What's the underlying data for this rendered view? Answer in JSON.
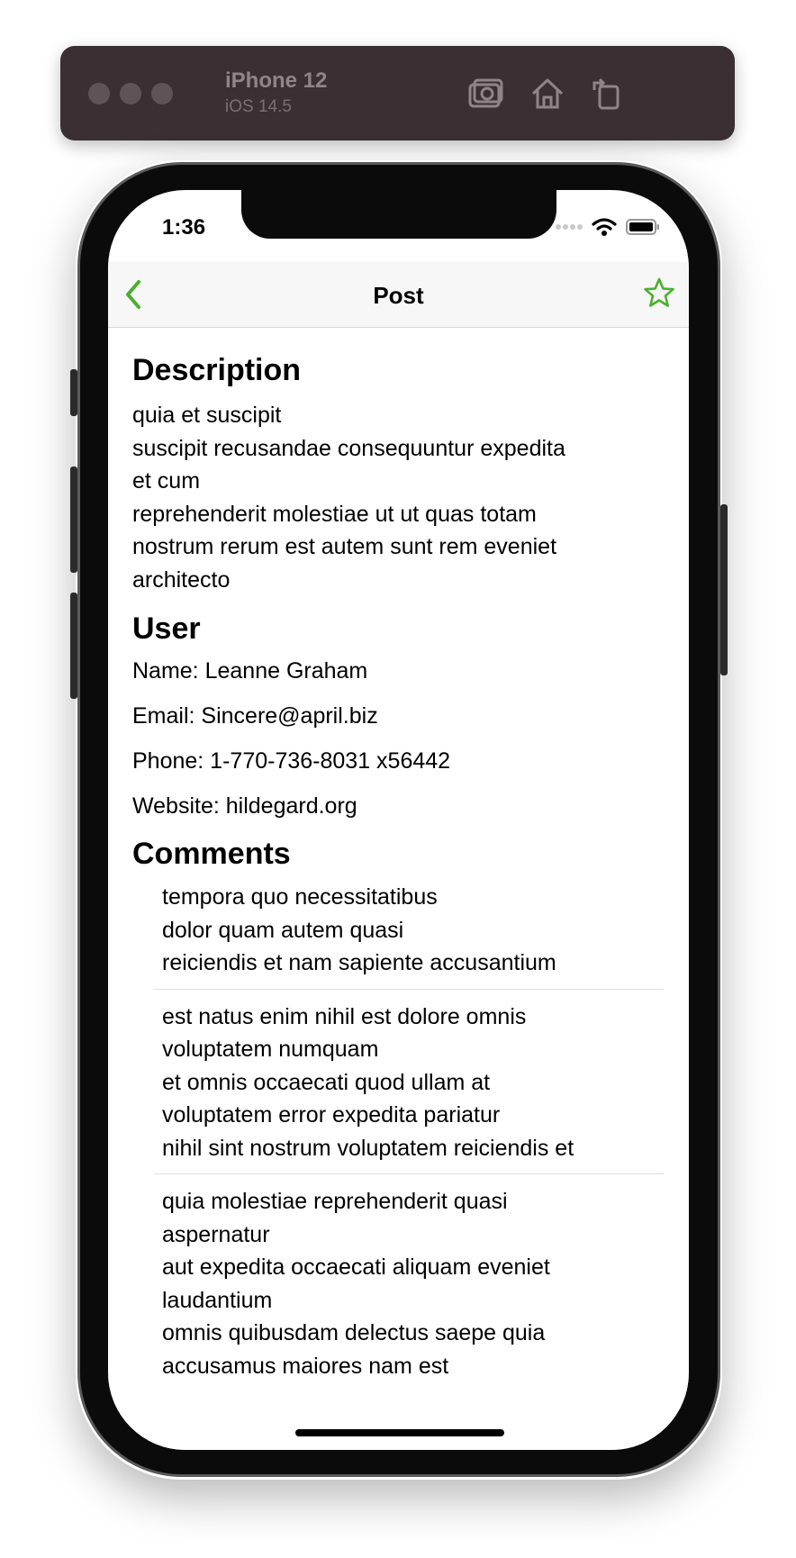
{
  "simulator": {
    "device": "iPhone 12",
    "os": "iOS 14.5",
    "icons": [
      "screenshot-icon",
      "home-icon",
      "rotate-icon"
    ]
  },
  "status_bar": {
    "time": "1:36"
  },
  "nav": {
    "title": "Post",
    "back_icon": "chevron-left-icon",
    "favorite_icon": "star-outline-icon",
    "accent_color": "#4caf2f"
  },
  "description": {
    "heading": "Description",
    "body": "quia et suscipit\nsuscipit recusandae consequuntur expedita\net cum\nreprehenderit molestiae ut ut quas totam\nnostrum rerum est autem sunt rem eveniet\narchitecto"
  },
  "user": {
    "heading": "User",
    "name": "Name: Leanne Graham",
    "email": "Email: Sincere@april.biz",
    "phone": "Phone: 1-770-736-8031 x56442",
    "website": "Website: hildegard.org"
  },
  "comments": {
    "heading": "Comments",
    "items": [
      "tempora quo necessitatibus\ndolor quam autem quasi\nreiciendis et nam sapiente accusantium",
      "est natus enim nihil est dolore omnis\nvoluptatem numquam\net omnis occaecati quod ullam at\nvoluptatem error expedita pariatur\nnihil sint nostrum voluptatem reiciendis et",
      "quia molestiae reprehenderit quasi\naspernatur\naut expedita occaecati aliquam eveniet\nlaudantium\nomnis quibusdam delectus saepe quia\naccusamus maiores nam est"
    ]
  }
}
